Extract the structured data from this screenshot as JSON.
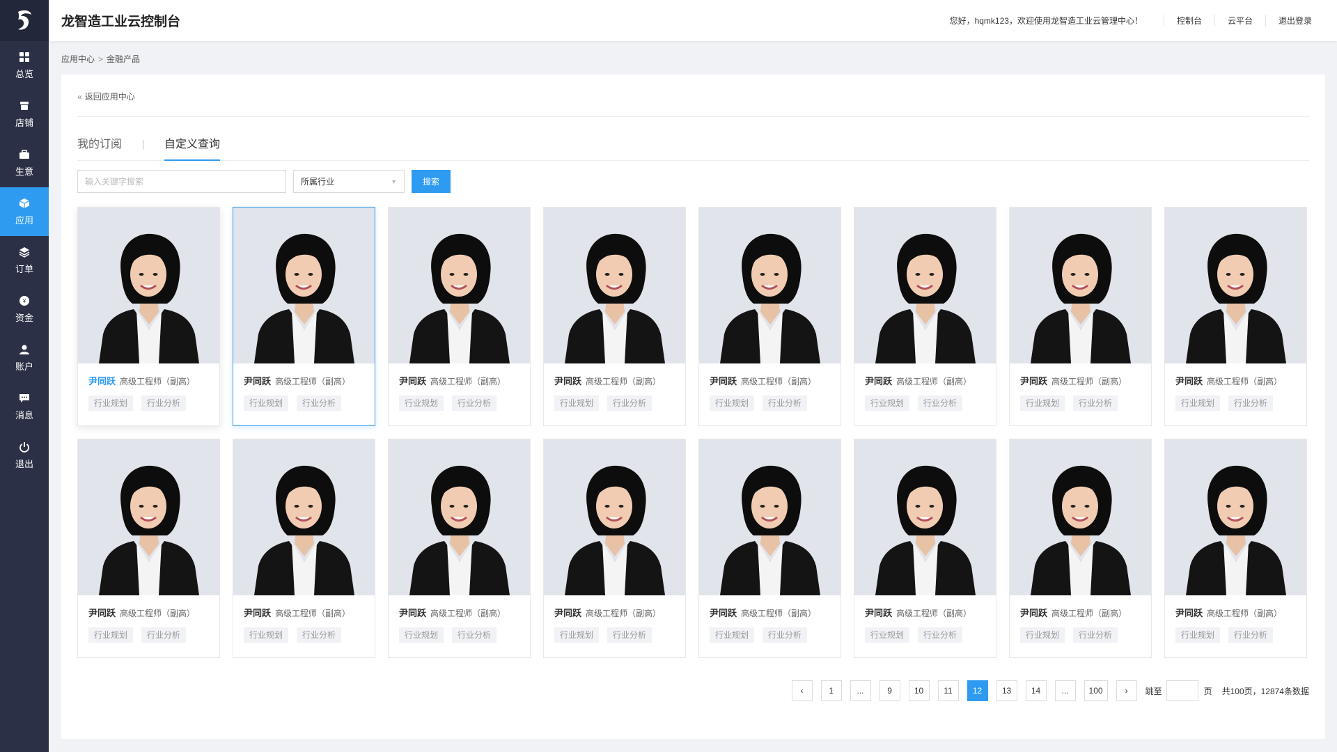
{
  "app": {
    "title": "龙智造工业云控制台"
  },
  "header": {
    "welcome": "您好，hqmk123，欢迎使用龙智造工业云管理中心！",
    "links": [
      "控制台",
      "云平台",
      "退出登录"
    ]
  },
  "sidebar": {
    "items": [
      {
        "label": "总览",
        "icon": "grid-icon"
      },
      {
        "label": "店铺",
        "icon": "store-icon"
      },
      {
        "label": "生意",
        "icon": "briefcase-icon"
      },
      {
        "label": "应用",
        "icon": "cube-icon",
        "active": true
      },
      {
        "label": "订单",
        "icon": "layers-icon"
      },
      {
        "label": "资金",
        "icon": "coin-icon"
      },
      {
        "label": "账户",
        "icon": "user-icon"
      },
      {
        "label": "消息",
        "icon": "message-icon"
      },
      {
        "label": "退出",
        "icon": "power-icon"
      }
    ]
  },
  "breadcrumb": {
    "items": [
      "应用中心",
      "金融产品"
    ],
    "separator": ">"
  },
  "back_link": "返回应用中心",
  "tabs": [
    {
      "label": "我的订阅",
      "active": false
    },
    {
      "label": "自定义查询",
      "active": true
    }
  ],
  "search": {
    "placeholder": "输入关键字搜索",
    "value": "",
    "industry_select": "所属行业",
    "button": "搜索"
  },
  "cards": [
    {
      "name": "尹同跃",
      "title": "高级工程师（副高）",
      "tags": [
        "行业规划",
        "行业分析"
      ],
      "state": "hover"
    },
    {
      "name": "尹同跃",
      "title": "高级工程师（副高）",
      "tags": [
        "行业规划",
        "行业分析"
      ],
      "state": "selected"
    },
    {
      "name": "尹同跃",
      "title": "高级工程师（副高）",
      "tags": [
        "行业规划",
        "行业分析"
      ]
    },
    {
      "name": "尹同跃",
      "title": "高级工程师（副高）",
      "tags": [
        "行业规划",
        "行业分析"
      ]
    },
    {
      "name": "尹同跃",
      "title": "高级工程师（副高）",
      "tags": [
        "行业规划",
        "行业分析"
      ]
    },
    {
      "name": "尹同跃",
      "title": "高级工程师（副高）",
      "tags": [
        "行业规划",
        "行业分析"
      ]
    },
    {
      "name": "尹同跃",
      "title": "高级工程师（副高）",
      "tags": [
        "行业规划",
        "行业分析"
      ]
    },
    {
      "name": "尹同跃",
      "title": "高级工程师（副高）",
      "tags": [
        "行业规划",
        "行业分析"
      ]
    },
    {
      "name": "尹同跃",
      "title": "高级工程师（副高）",
      "tags": [
        "行业规划",
        "行业分析"
      ]
    },
    {
      "name": "尹同跃",
      "title": "高级工程师（副高）",
      "tags": [
        "行业规划",
        "行业分析"
      ]
    },
    {
      "name": "尹同跃",
      "title": "高级工程师（副高）",
      "tags": [
        "行业规划",
        "行业分析"
      ]
    },
    {
      "name": "尹同跃",
      "title": "高级工程师（副高）",
      "tags": [
        "行业规划",
        "行业分析"
      ]
    },
    {
      "name": "尹同跃",
      "title": "高级工程师（副高）",
      "tags": [
        "行业规划",
        "行业分析"
      ]
    },
    {
      "name": "尹同跃",
      "title": "高级工程师（副高）",
      "tags": [
        "行业规划",
        "行业分析"
      ]
    },
    {
      "name": "尹同跃",
      "title": "高级工程师（副高）",
      "tags": [
        "行业规划",
        "行业分析"
      ]
    },
    {
      "name": "尹同跃",
      "title": "高级工程师（副高）",
      "tags": [
        "行业规划",
        "行业分析"
      ]
    }
  ],
  "pagination": {
    "pages": [
      "1",
      "...",
      "9",
      "10",
      "11",
      "12",
      "13",
      "14",
      "...",
      "100"
    ],
    "current": "12",
    "jump_label": "跳至",
    "jump_value": "",
    "page_unit": "页",
    "total_text": "共100页，12874条数据"
  },
  "colors": {
    "accent": "#2e9bf0",
    "sidebar_bg": "#2b3046",
    "photo_bg": "#e1e4ea"
  }
}
